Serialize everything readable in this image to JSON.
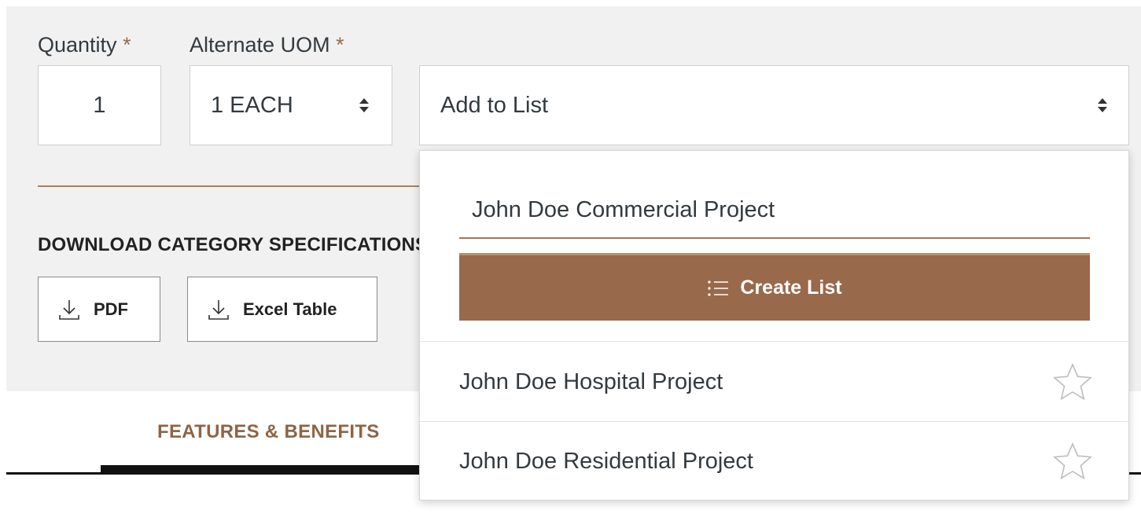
{
  "form": {
    "quantity_label": "Quantity",
    "uom_label": "Alternate UOM",
    "required_mark": "*",
    "quantity_value": "1",
    "uom_value": "1 EACH",
    "add_to_list_value": "Add to List"
  },
  "downloads": {
    "heading": "DOWNLOAD CATEGORY SPECIFICATIONS",
    "pdf_label": "PDF",
    "excel_label": "Excel Table"
  },
  "tabs": {
    "features_label": "FEATURES & BENEFITS"
  },
  "dropdown": {
    "new_list_value": "John Doe Commercial Project",
    "create_button_label": "Create List",
    "items": [
      {
        "label": "John Doe Hospital Project"
      },
      {
        "label": "John Doe Residential Project"
      }
    ]
  },
  "colors": {
    "accent": "#99694b",
    "required": "#9a6a4c",
    "panel_bg": "#f1f1f1"
  }
}
